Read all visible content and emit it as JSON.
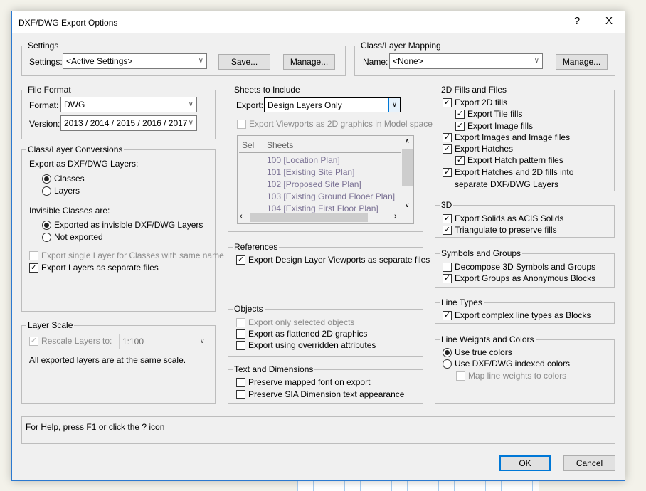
{
  "window": {
    "title": "DXF/DWG Export Options",
    "help": "?",
    "close": "X"
  },
  "settings": {
    "group": "Settings",
    "label": "Settings:",
    "value": "<Active Settings>",
    "save": "Save...",
    "manage": "Manage..."
  },
  "mapping": {
    "group": "Class/Layer Mapping",
    "label": "Name:",
    "value": "<None>",
    "manage": "Manage..."
  },
  "file_format": {
    "group": "File Format",
    "format_label": "Format:",
    "format": "DWG",
    "version_label": "Version:",
    "version": "2013 / 2014 / 2015 / 2016 / 2017"
  },
  "conversions": {
    "group": "Class/Layer Conversions",
    "export_as": "Export as DXF/DWG Layers:",
    "r_classes": {
      "label": "Classes",
      "on": true
    },
    "r_layers": {
      "label": "Layers",
      "on": false
    },
    "invisible": "Invisible Classes are:",
    "r_exported": {
      "label": "Exported as invisible DXF/DWG Layers",
      "on": true
    },
    "r_not": {
      "label": "Not exported",
      "on": false
    },
    "single": {
      "label": "Export single Layer for Classes with same name",
      "on": false,
      "disabled": true
    },
    "separate": {
      "label": "Export Layers as separate files",
      "on": true
    }
  },
  "layer_scale": {
    "group": "Layer Scale",
    "rescale": {
      "label": "Rescale Layers to:",
      "on": true,
      "disabled": true
    },
    "scale": "1:100",
    "note": "All exported layers are at the same scale."
  },
  "sheets": {
    "group": "Sheets to Include",
    "export_label": "Export:",
    "export_value": "Design Layers Only",
    "viewports": {
      "label": "Export Viewports as 2D graphics in Model space",
      "on": false,
      "disabled": true
    },
    "columns": [
      "Sel",
      "Sheets"
    ],
    "rows": [
      "100 [Location Plan]",
      "101 [Existing Site Plan]",
      "102 [Proposed Site Plan]",
      "103 [Existing Ground Flooer Plan]",
      "104 [Existing First Floor Plan]"
    ]
  },
  "references": {
    "group": "References",
    "dlvp": {
      "label": "Export Design Layer Viewports as separate files",
      "on": true
    }
  },
  "objects": {
    "group": "Objects",
    "selected": {
      "label": "Export only selected objects",
      "on": false,
      "disabled": true
    },
    "flattened": {
      "label": "Export as flattened 2D graphics",
      "on": false
    },
    "overridden": {
      "label": "Export using overridden attributes",
      "on": false
    }
  },
  "text_dims": {
    "group": "Text and Dimensions",
    "font": {
      "label": "Preserve mapped font on export",
      "on": false
    },
    "sia": {
      "label": "Preserve SIA Dimension text appearance",
      "on": false
    }
  },
  "fills": {
    "group": "2D Fills and Files",
    "fills": {
      "label": "Export 2D fills",
      "on": true
    },
    "tile": {
      "label": "Export Tile fills",
      "on": true
    },
    "image": {
      "label": "Export Image fills",
      "on": true
    },
    "images": {
      "label": "Export Images and Image files",
      "on": true
    },
    "hatches": {
      "label": "Export Hatches",
      "on": true
    },
    "hatch_files": {
      "label": "Export Hatch pattern files",
      "on": true
    },
    "sep1": {
      "label": "Export Hatches and 2D fills into",
      "on": true
    },
    "sep2": "separate DXF/DWG Layers"
  },
  "three_d": {
    "group": "3D",
    "acis": {
      "label": "Export Solids as ACIS Solids",
      "on": true
    },
    "tri": {
      "label": "Triangulate to preserve fills",
      "on": true
    }
  },
  "symbols": {
    "group": "Symbols and Groups",
    "decompose": {
      "label": "Decompose 3D Symbols and Groups",
      "on": false
    },
    "anon": {
      "label": "Export Groups as Anonymous Blocks",
      "on": true
    }
  },
  "line_types": {
    "group": "Line Types",
    "complex": {
      "label": "Export complex line types as Blocks",
      "on": true
    }
  },
  "line_weights": {
    "group": "Line Weights and Colors",
    "true_colors": {
      "label": "Use true colors",
      "on": true
    },
    "indexed": {
      "label": "Use DXF/DWG indexed colors",
      "on": false
    },
    "map": {
      "label": "Map line weights to colors",
      "on": false,
      "disabled": true
    }
  },
  "help": "For Help, press F1 or click the ? icon",
  "buttons": {
    "ok": "OK",
    "cancel": "Cancel"
  }
}
